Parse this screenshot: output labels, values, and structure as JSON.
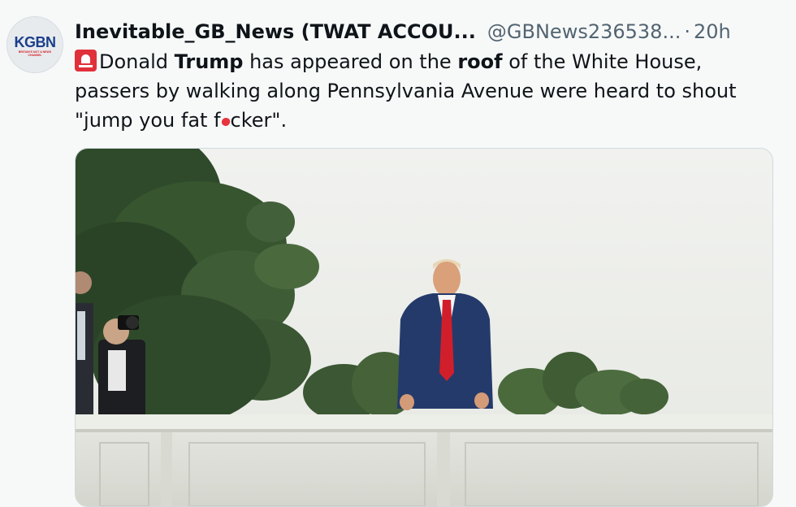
{
  "tweet": {
    "avatar": {
      "logo_main": "KGBN",
      "logo_tag": "BRITAIN'S NOT A NEWS CHANNEL"
    },
    "author": {
      "display_name": "Inevitable_GB_News (TWAT ACCOU...",
      "handle": "@GBNews236538...",
      "separator": "·",
      "time": "20h"
    },
    "text": {
      "emoji": "siren-icon",
      "part1": "Donald ",
      "bold1": "Trump",
      "part2": " has appeared on the ",
      "bold2": "roof",
      "part3": " of the White House, passers by walking along Pennsylvania Avenue were heard to shout \"jump you fat f",
      "part4": "cker\"."
    },
    "colors": {
      "background": "#f7f9f9",
      "text": "#0f1419",
      "secondary_text": "#536471",
      "logo_blue": "#1b3f8b",
      "logo_red": "#d3202a",
      "siren_red": "#e0303a"
    }
  }
}
